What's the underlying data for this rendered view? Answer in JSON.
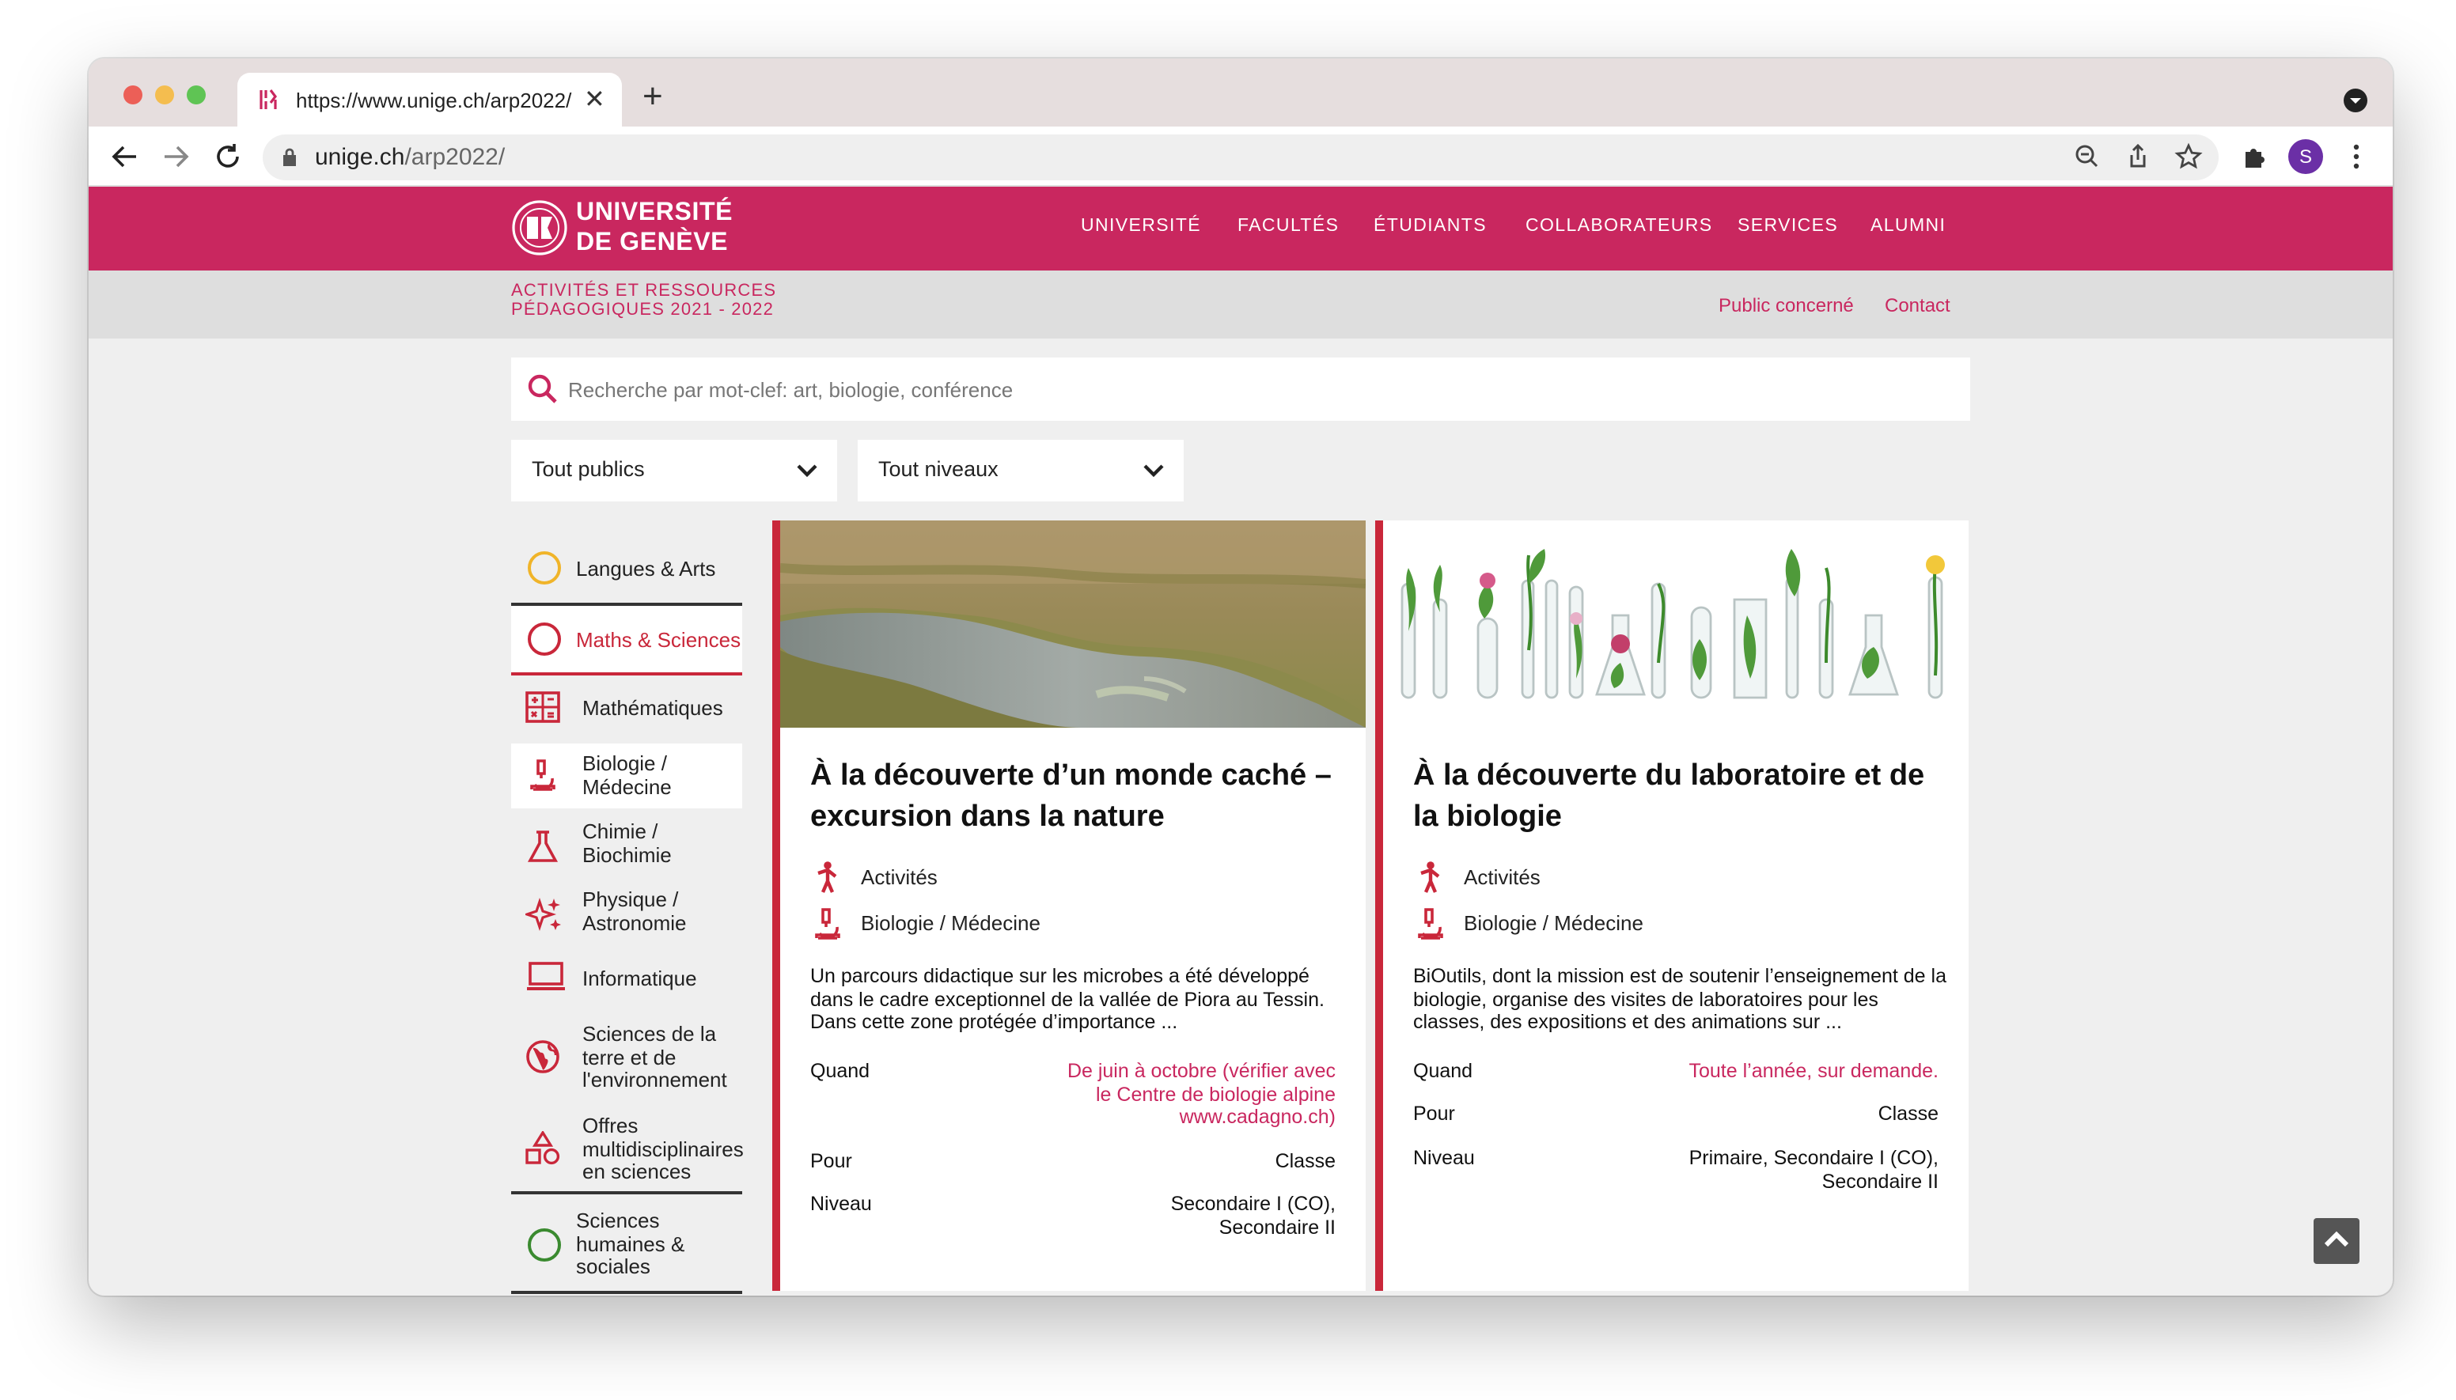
{
  "browser": {
    "tab_title": "https://www.unige.ch/arp2022/",
    "url_host": "unige.ch",
    "url_path": "/arp2022/",
    "profile_initial": "S"
  },
  "header": {
    "logo_line1": "UNIVERSITÉ",
    "logo_line2": "DE GENÈVE",
    "nav": [
      "UNIVERSITÉ",
      "FACULTÉS",
      "ÉTUDIANTS",
      "COLLABORATEURS",
      "SERVICES",
      "ALUMNI"
    ],
    "brand_color": "#c9275f"
  },
  "subheader": {
    "title_line1": "ACTIVITÉS ET RESSOURCES",
    "title_line2": "PÉDAGOGIQUES 2021 - 2022",
    "links": [
      "Public concerné",
      "Contact"
    ]
  },
  "search": {
    "placeholder": "Recherche par mot-clef: art, biologie, conférence"
  },
  "filters": {
    "public": "Tout publics",
    "niveau": "Tout niveaux"
  },
  "sidebar": {
    "categories": [
      {
        "label": "Langues & Arts",
        "color": "#f0b429"
      },
      {
        "label": "Maths & Sciences",
        "color": "#c9273a"
      },
      {
        "label": "Sciences humaines & sociales",
        "color": "#3a8a2f"
      }
    ],
    "subitems": [
      {
        "label": "Mathématiques",
        "icon": "calculator-icon"
      },
      {
        "label": "Biologie / Médecine",
        "icon": "microscope-icon"
      },
      {
        "label": "Chimie / Biochimie",
        "icon": "flask-icon"
      },
      {
        "label": "Physique / Astronomie",
        "icon": "sparkles-icon"
      },
      {
        "label": "Informatique",
        "icon": "laptop-icon"
      },
      {
        "label": "Sciences de la terre et de l'environnement",
        "icon": "globe-icon"
      },
      {
        "label": "Offres multidisciplinaires en sciences",
        "icon": "shapes-icon"
      }
    ]
  },
  "cards": [
    {
      "title": "À la découverte d’un monde caché – excursion dans la nature",
      "type": "Activités",
      "domain": "Biologie / Médecine",
      "description": "Un parcours didactique sur les microbes a été développé dans le cadre exceptionnel de la vallée de Piora au Tessin. Dans cette zone protégée d’importance ...",
      "when_label": "Quand",
      "when_value": "De juin à octobre (vérifier avec le Centre de biologie alpine www.cadagno.ch)",
      "for_label": "Pour",
      "for_value": "Classe",
      "level_label": "Niveau",
      "level_value": "Secondaire I (CO), Secondaire II"
    },
    {
      "title": "À la découverte du laboratoire et de la biologie",
      "type": "Activités",
      "domain": "Biologie / Médecine",
      "description": "BiOutils, dont la mission est de soutenir l’enseignement de la biologie, organise des visites de laboratoires pour les classes, des expositions et des animations sur ...",
      "when_label": "Quand",
      "when_value": "Toute l’année, sur demande.",
      "for_label": "Pour",
      "for_value": "Classe",
      "level_label": "Niveau",
      "level_value": "Primaire, Secondaire I (CO), Secondaire II"
    }
  ]
}
